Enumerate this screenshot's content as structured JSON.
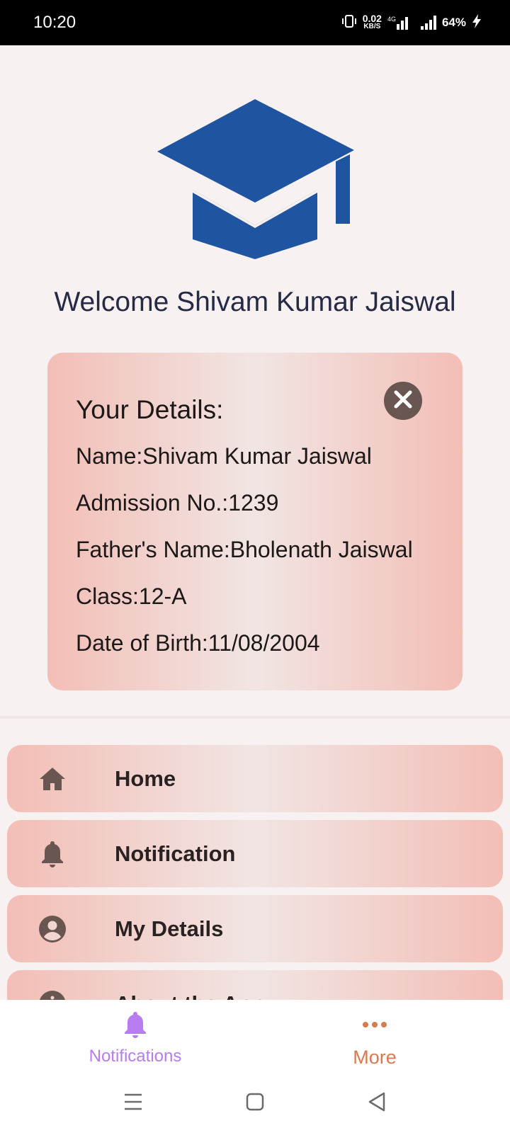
{
  "status_bar": {
    "time": "10:20",
    "net_speed_value": "0.02",
    "net_speed_unit": "KB/S",
    "network_type": "4G",
    "battery": "64%"
  },
  "header": {
    "logo": "graduation-cap-icon",
    "logo_color": "#1f54a0",
    "welcome": "Welcome Shivam Kumar Jaiswal"
  },
  "details_card": {
    "title": "Your Details:",
    "lines": [
      "Name:Shivam Kumar Jaiswal",
      "Admission No.:1239",
      "Father's Name:Bholenath Jaiswal",
      "Class:12-A",
      "Date of Birth:11/08/2004"
    ],
    "close_icon": "close-icon"
  },
  "menu": {
    "items": [
      {
        "label": "Home",
        "icon": "home-icon"
      },
      {
        "label": "Notification",
        "icon": "bell-icon"
      },
      {
        "label": "My Details",
        "icon": "account-circle-icon"
      },
      {
        "label": "About the App",
        "icon": "info-icon"
      }
    ]
  },
  "bottom_nav": {
    "tabs": [
      {
        "label": "Notifications",
        "icon": "bell-icon",
        "color": "#b67cf0"
      },
      {
        "label": "More",
        "icon": "more-dots-icon",
        "color": "#d87a50"
      }
    ]
  },
  "system_nav": {
    "buttons": [
      "menu-icon",
      "home-square-icon",
      "back-triangle-icon"
    ]
  }
}
